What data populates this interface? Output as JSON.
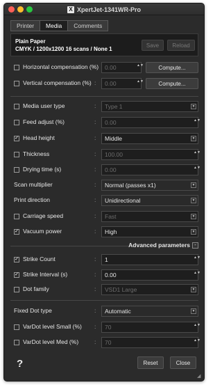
{
  "window": {
    "title": "XpertJet-1341WR-Pro",
    "app_icon_glyph": "X"
  },
  "tabs": [
    {
      "label": "Printer",
      "active": false
    },
    {
      "label": "Media",
      "active": true
    },
    {
      "label": "Comments",
      "active": false
    }
  ],
  "header": {
    "media_name": "Plain Paper",
    "media_details": "CMYK / 1200x1200 16 scans / None 1",
    "save_label": "Save",
    "reload_label": "Reload"
  },
  "compensation": {
    "horizontal": {
      "label": "Horizontal compensation (%)",
      "checked": false,
      "value": "0.00",
      "button": "Compute..."
    },
    "vertical": {
      "label": "Vertical compensation (%)",
      "checked": false,
      "value": "0.00",
      "button": "Compute..."
    }
  },
  "media_settings": {
    "media_user_type": {
      "label": "Media user type",
      "checked": false,
      "value": "Type 1"
    },
    "feed_adjust": {
      "label": "Feed adjust (%)",
      "checked": false,
      "value": "0.00"
    },
    "head_height": {
      "label": "Head height",
      "checked": true,
      "value": "Middle"
    },
    "thickness": {
      "label": "Thickness",
      "checked": false,
      "value": "100.00"
    },
    "drying_time": {
      "label": "Drying time (s)",
      "checked": false,
      "value": "0.00"
    },
    "scan_multiplier": {
      "label": "Scan multiplier",
      "value": "Normal (passes x1)"
    },
    "print_direction": {
      "label": "Print direction",
      "value": "Unidirectional"
    },
    "carriage_speed": {
      "label": "Carriage speed",
      "checked": false,
      "value": "Fast"
    },
    "vacuum_power": {
      "label": "Vacuum power",
      "checked": true,
      "value": "High"
    }
  },
  "advanced": {
    "label": "Advanced parameters",
    "toggle": "-",
    "strike_count": {
      "label": "Strike Count",
      "checked": true,
      "value": "1"
    },
    "strike_interval": {
      "label": "Strike Interval (s)",
      "checked": true,
      "value": "0.00"
    },
    "dot_family": {
      "label": "Dot family",
      "checked": false,
      "value": "VSD1 Large"
    }
  },
  "dot": {
    "fixed_dot_type": {
      "label": "Fixed Dot type",
      "value": "Automatic"
    },
    "vardot_small": {
      "label": "VarDot level Small (%)",
      "checked": false,
      "value": "70"
    },
    "vardot_med": {
      "label": "VarDot level Med (%)",
      "checked": false,
      "value": "70"
    }
  },
  "footer": {
    "help": "?",
    "reset_label": "Reset",
    "close_label": "Close"
  },
  "common": {
    "colon": ":",
    "check": "✓",
    "caret": "▼",
    "spin": "▲▼",
    "resize": "◢"
  },
  "colors": {
    "window_bg": "#2b2b2b",
    "field_bg": "#1e1e1e",
    "text": "#e6e6e6",
    "disabled_text": "#6c6c6c"
  }
}
